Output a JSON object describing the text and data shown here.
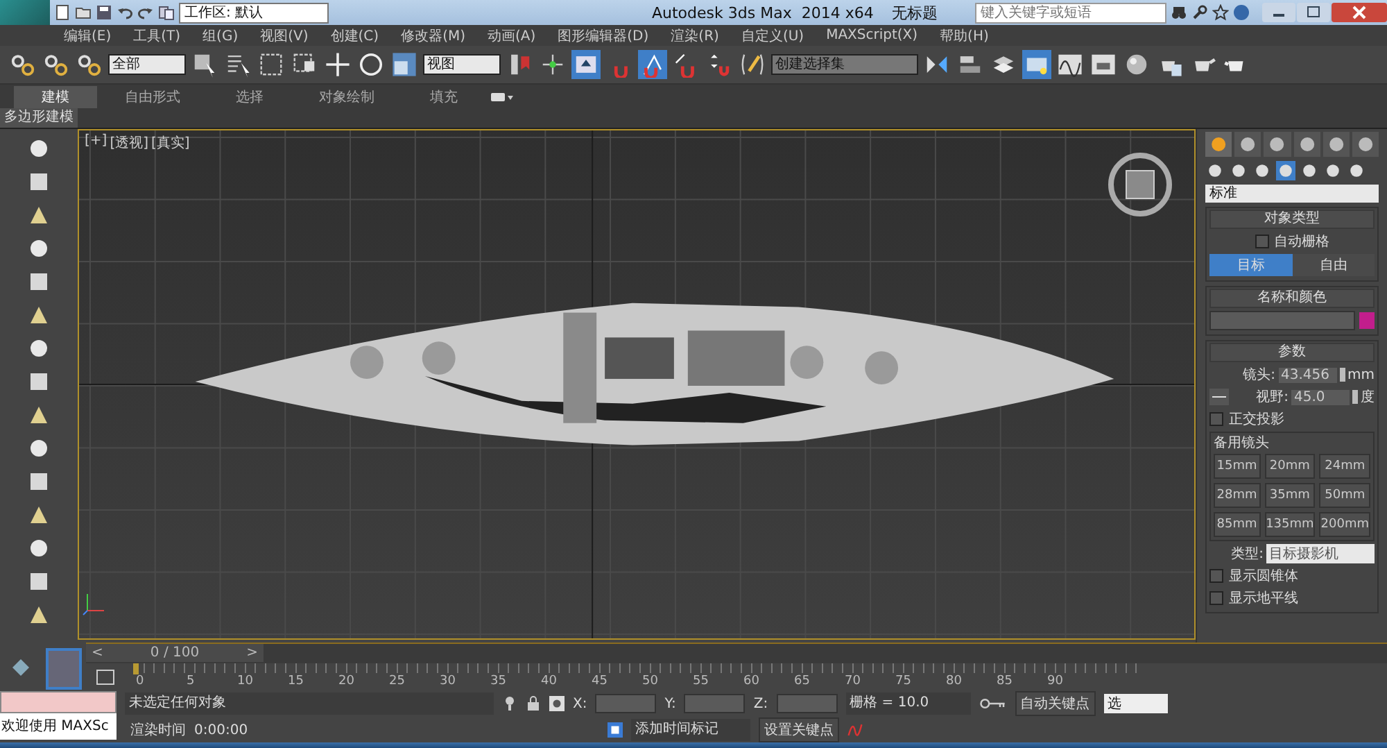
{
  "title_bar": {
    "workspace": "工作区: 默认",
    "title": "Autodesk 3ds Max  2014 x64",
    "document": "无标题",
    "search": {
      "placeholder": "键入关键字或短语"
    }
  },
  "menu": [
    "编辑(E)",
    "工具(T)",
    "组(G)",
    "视图(V)",
    "创建(C)",
    "修改器(M)",
    "动画(A)",
    "图形编辑器(D)",
    "渲染(R)",
    "自定义(U)",
    "MAXScript(X)",
    "帮助(H)"
  ],
  "toolbar": {
    "selection_filter": "全部",
    "reference_coord": "视图",
    "named_selection": "创建选择集"
  },
  "ribbon": {
    "tabs": [
      {
        "label": "建模",
        "selected": true
      },
      {
        "label": "自由形式",
        "selected": false
      },
      {
        "label": "选择",
        "selected": false
      },
      {
        "label": "对象绘制",
        "selected": false
      },
      {
        "label": "填充",
        "selected": false
      }
    ],
    "panel": "多边形建模"
  },
  "viewport": {
    "labels": [
      "[+]",
      "[透视]",
      "[真实]"
    ]
  },
  "command_panel": {
    "category": "标准",
    "object_type": {
      "title": "对象类型",
      "autogrid": {
        "label": "自动栅格",
        "checked": false
      },
      "buttons": [
        {
          "label": "目标",
          "selected": true
        },
        {
          "label": "自由",
          "selected": false
        }
      ]
    },
    "name_color": {
      "title": "名称和颜色",
      "color": "#c21e8c"
    },
    "parameters": {
      "title": "参数",
      "lens_label": "镜头:",
      "lens": "43.456",
      "lens_unit": "mm",
      "fov_label": "视野:",
      "fov": "45.0",
      "fov_unit": "度",
      "ortho": {
        "label": "正交投影",
        "checked": false
      },
      "stock_title": "备用镜头",
      "stock_lenses": [
        "15mm",
        "20mm",
        "24mm",
        "28mm",
        "35mm",
        "50mm",
        "85mm",
        "135mm",
        "200mm"
      ],
      "type_label": "类型:",
      "type": "目标摄影机",
      "options": [
        {
          "label": "显示圆锥体",
          "checked": false
        },
        {
          "label": "显示地平线",
          "checked": false
        }
      ]
    }
  },
  "timeline": {
    "prev": "<",
    "frame": "0 / 100",
    "next": ">",
    "ticks": [
      "0",
      "5",
      "10",
      "15",
      "20",
      "25",
      "30",
      "35",
      "40",
      "45",
      "50",
      "55",
      "60",
      "65",
      "70",
      "75",
      "80",
      "85",
      "90"
    ]
  },
  "status": {
    "maxscript": "欢迎使用 MAXSc",
    "selection": "未选定任何对象",
    "x_label": "X:",
    "y_label": "Y:",
    "z_label": "Z:",
    "grid": "栅格 = 10.0",
    "auto_key": "自动关键点",
    "key_filter": "选",
    "render_time_label": "渲染时间",
    "render_time": "0:00:00",
    "add_time_tag": "添加时间标记",
    "set_key": "设置关键点"
  }
}
